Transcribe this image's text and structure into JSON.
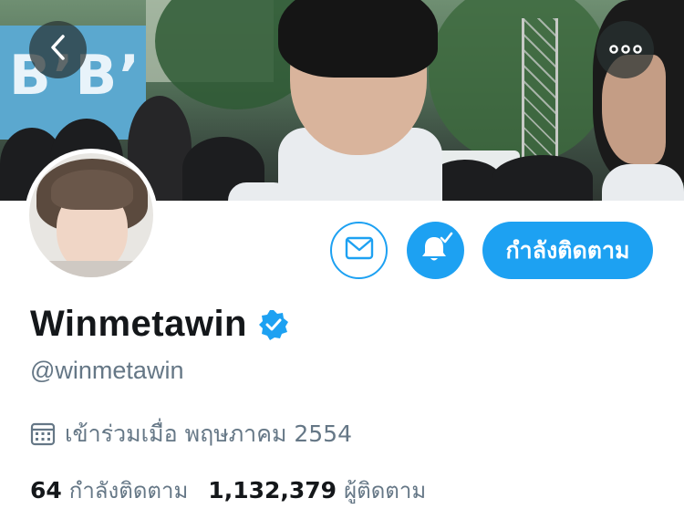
{
  "banner": {
    "sign_text": "B’B’"
  },
  "nav": {
    "back_icon": "chevron-left-icon",
    "more_icon": "more-horizontal-icon"
  },
  "profile": {
    "display_name": "Winmetawin",
    "handle": "@winmetawin",
    "verified": true,
    "joined_text": "เข้าร่วมเมื่อ พฤษภาคม 2554",
    "following_count": "64",
    "following_label": "กำลังติดตาม",
    "followers_count": "1,132,379",
    "followers_label": "ผู้ติดตาม"
  },
  "actions": {
    "message_icon": "envelope-icon",
    "notifications_icon": "bell-check-icon",
    "follow_label": "กำลังติดตาม"
  },
  "colors": {
    "accent": "#1da1f2",
    "text_primary": "#14171a",
    "text_secondary": "#657786"
  }
}
